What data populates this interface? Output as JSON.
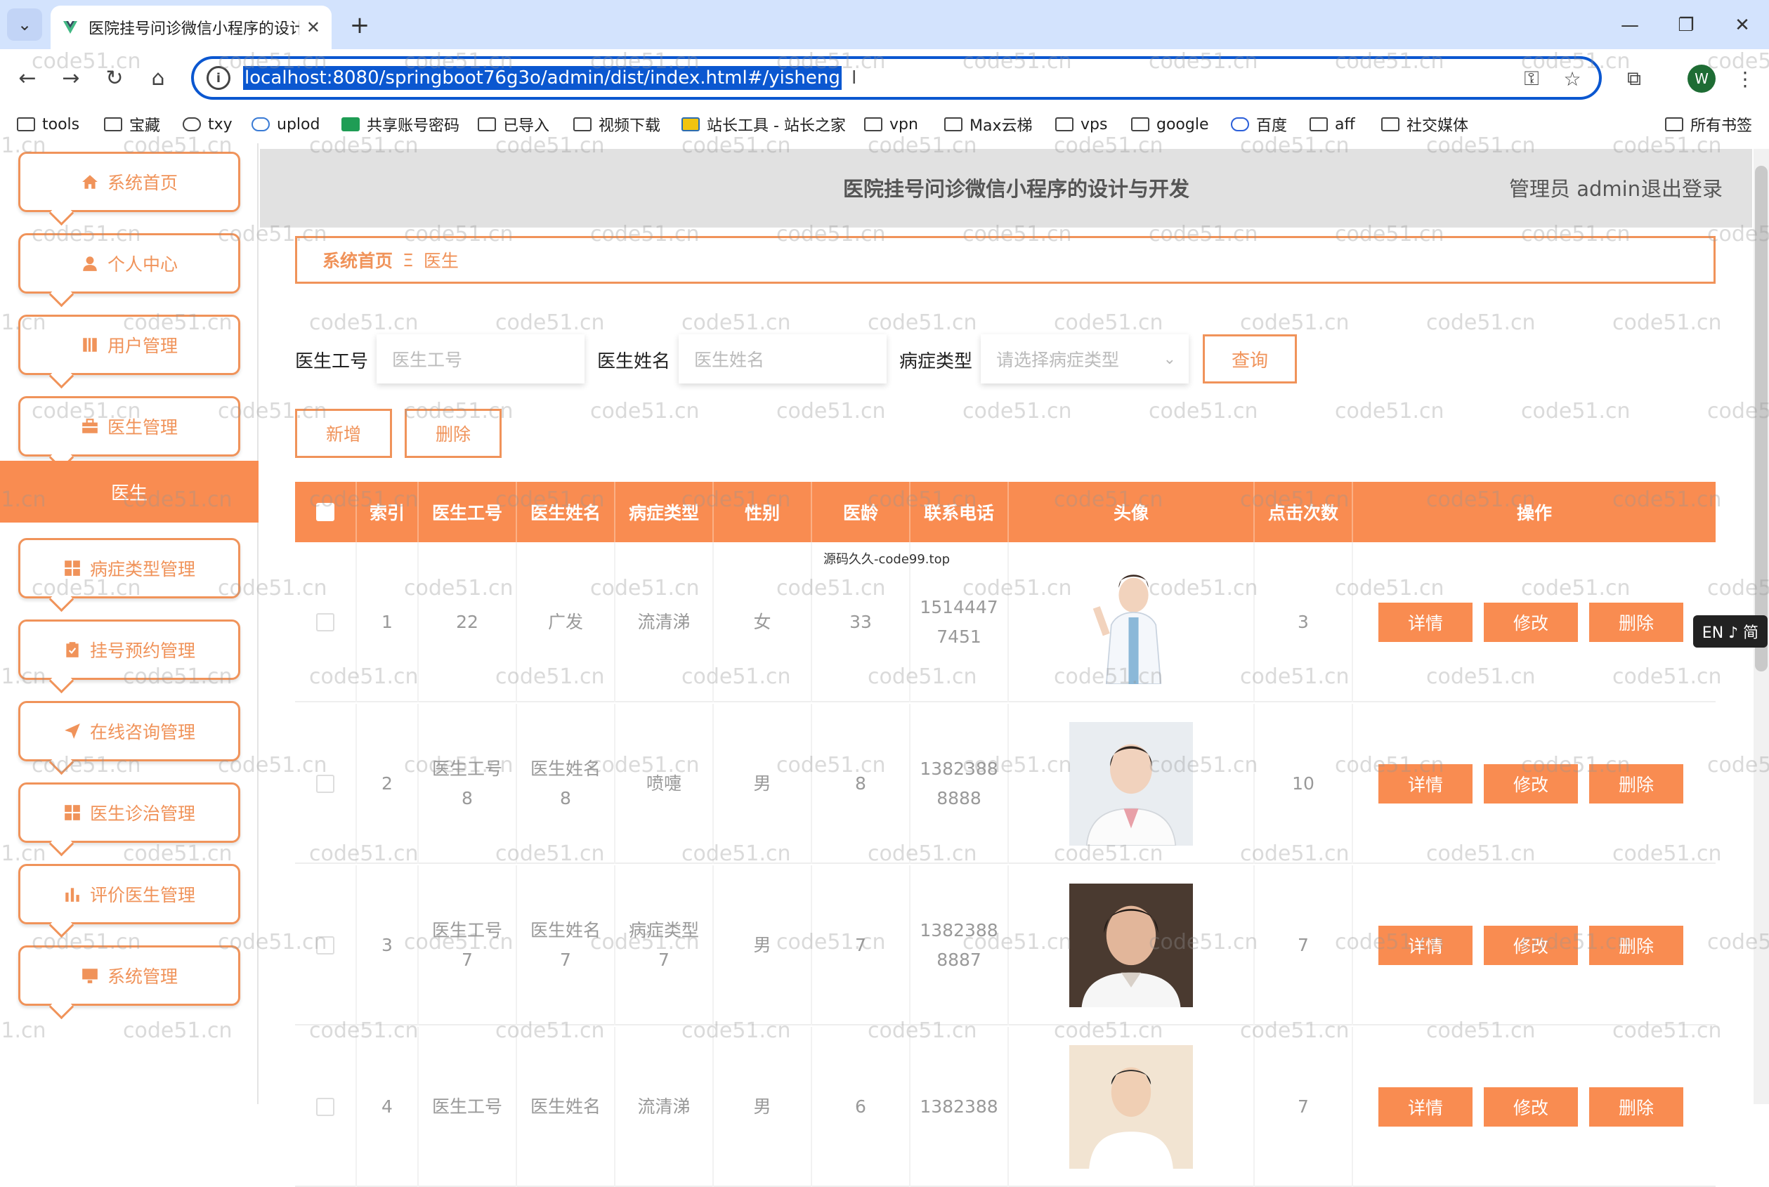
{
  "browser": {
    "tab_title": "医院挂号问诊微信小程序的设计",
    "url": "localhost:8080/springboot76g3o/admin/dist/index.html#/yisheng",
    "profile_initial": "W",
    "bookmarks": [
      "tools",
      "宝藏",
      "txy",
      "uplod",
      "共享账号密码",
      "已导入",
      "视频下载",
      "站长工具 - 站长之家",
      "vpn",
      "Max云梯",
      "vps",
      "google",
      "百度",
      "aff",
      "社交媒体"
    ],
    "all_bookmarks": "所有书签"
  },
  "header": {
    "title": "医院挂号问诊微信小程序的设计与开发",
    "admin_label": "管理员 admin",
    "logout": "退出登录"
  },
  "sidebar": {
    "items": [
      {
        "label": "系统首页",
        "icon": "home-icon"
      },
      {
        "label": "个人中心",
        "icon": "user-icon"
      },
      {
        "label": "用户管理",
        "icon": "book-icon"
      },
      {
        "label": "医生管理",
        "icon": "briefcase-icon"
      },
      {
        "label": "病症类型管理",
        "icon": "grid-icon"
      },
      {
        "label": "挂号预约管理",
        "icon": "clipboard-icon"
      },
      {
        "label": "在线咨询管理",
        "icon": "send-icon"
      },
      {
        "label": "医生诊治管理",
        "icon": "grid-icon"
      },
      {
        "label": "评价医生管理",
        "icon": "bar-chart-icon"
      },
      {
        "label": "系统管理",
        "icon": "monitor-icon"
      }
    ],
    "active_sub": "医生"
  },
  "breadcrumb": {
    "home": "系统首页",
    "sep": "Ξ",
    "current": "医生"
  },
  "filters": {
    "id_label": "医生工号",
    "id_placeholder": "医生工号",
    "name_label": "医生姓名",
    "name_placeholder": "医生姓名",
    "type_label": "病症类型",
    "type_placeholder": "请选择病症类型",
    "query": "查询"
  },
  "actions": {
    "add": "新增",
    "delete": "删除"
  },
  "table": {
    "columns": [
      "索引",
      "医生工号",
      "医生姓名",
      "病症类型",
      "性别",
      "医龄",
      "联系电话",
      "头像",
      "点击次数",
      "操作"
    ],
    "row1_note": "源码久久-code99.top",
    "ops": {
      "detail": "详情",
      "edit": "修改",
      "delete": "删除"
    },
    "rows": [
      {
        "index": "1",
        "id": "22",
        "name": "广发",
        "type": "流清涕",
        "gender": "女",
        "years": "33",
        "phone_a": "1514447",
        "phone_b": "7451",
        "clicks": "3"
      },
      {
        "index": "2",
        "id": "医生工号\n8",
        "name": "医生姓名\n8",
        "type": "喷嚏",
        "gender": "男",
        "years": "8",
        "phone_a": "1382388",
        "phone_b": "8888",
        "clicks": "10"
      },
      {
        "index": "3",
        "id": "医生工号\n7",
        "name": "医生姓名\n7",
        "type": "病症类型\n7",
        "gender": "男",
        "years": "7",
        "phone_a": "1382388",
        "phone_b": "8887",
        "clicks": "7"
      },
      {
        "index": "4",
        "id": "医生工号",
        "name": "医生姓名",
        "type": "流清涕",
        "gender": "男",
        "years": "6",
        "phone_a": "1382388",
        "phone_b": "",
        "clicks": "7"
      }
    ]
  },
  "watermark": "code51.cn",
  "ime": "EN ♪ 简",
  "colors": {
    "accent": "#f98c51",
    "border": "#f0935a",
    "omnibox": "#0b57d0"
  }
}
